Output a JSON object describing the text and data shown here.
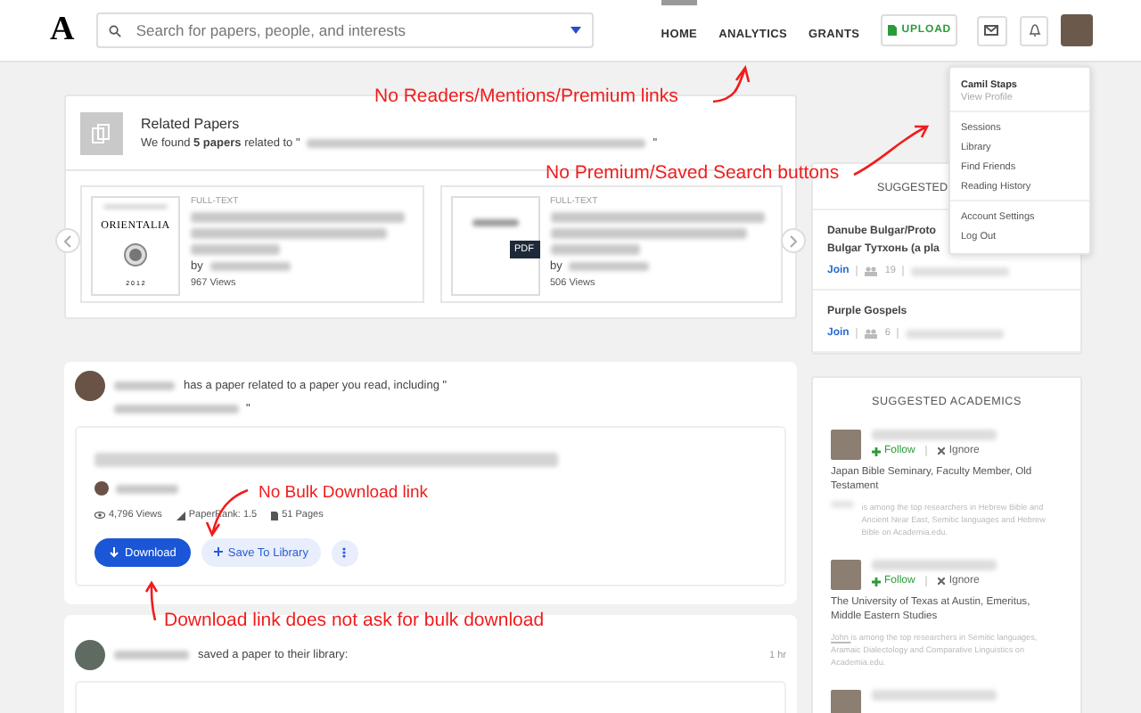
{
  "nav": {
    "logo": "A",
    "search_placeholder": "Search for papers, people, and interests",
    "links": [
      {
        "label": "HOME",
        "selected": true
      },
      {
        "label": "ANALYTICS",
        "selected": false
      },
      {
        "label": "GRANTS",
        "selected": false
      }
    ],
    "upload": "UPLOAD"
  },
  "related": {
    "title": "Related Papers",
    "intro": "We found **5 papers** related to \"",
    "close": "\"",
    "papers": [
      {
        "kind": "journal",
        "cover_title": "ORIENTALIA",
        "cover_year": "2 0 1 2",
        "tag": "FULL-TEXT",
        "by": "by",
        "views": "967 Views"
      },
      {
        "kind": "pdf",
        "badge": "PDF",
        "tag": "FULL-TEXT",
        "by": "by",
        "views": "506 Views"
      }
    ]
  },
  "feed": [
    {
      "kind": "paper",
      "action": "has a paper related to a paper you read, including \"",
      "close": "\"",
      "stats": {
        "views": "4,796 Views",
        "rank": "PaperRank: 1.5",
        "pages": "51 Pages"
      },
      "download": "Download",
      "save": "Save To Library"
    },
    {
      "kind": "saved",
      "action": "saved a paper to their library:",
      "time": "1 hr"
    }
  ],
  "groups": {
    "heading": "SUGGESTED",
    "items": [
      {
        "name": "Danube Bulgar/Proto Bulgar Тутхонь (a pla",
        "join": "Join",
        "members": "19"
      },
      {
        "name": "Purple Gospels",
        "join": "Join",
        "members": "6"
      }
    ]
  },
  "academics": {
    "heading": "SUGGESTED ACADEMICS",
    "people": [
      {
        "kind": "full",
        "follow": "Follow",
        "ignore": "Ignore",
        "affiliation": "Japan Bible Seminary, Faculty Member, Old Testament",
        "blurb": "is among the top researchers in Hebrew Bible and Ancient Near East, Semitic languages and Hebrew Bible on Academia.edu."
      },
      {
        "kind": "full",
        "follow": "Follow",
        "ignore": "Ignore",
        "affiliation": "The University of Texas at Austin, Emeritus, Middle Eastern Studies",
        "blurb_name": "John",
        "blurb": "is among the top researchers in Semitic languages, Aramaic Dialectology and Comparative Linguistics on Academia.edu."
      },
      {
        "kind": "partial"
      }
    ]
  },
  "menu": {
    "name": "Camil Staps",
    "profile": "View Profile",
    "sections": [
      [
        "Sessions",
        "Library",
        "Find Friends",
        "Reading History"
      ],
      [
        "Account Settings",
        "Log Out"
      ]
    ]
  },
  "annotations": [
    "No Readers/Mentions/Premium links",
    "No Premium/Saved Search buttons",
    "No Bulk Download link",
    "Download link does not ask for bulk download"
  ]
}
